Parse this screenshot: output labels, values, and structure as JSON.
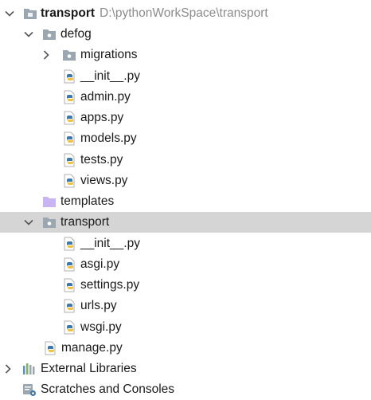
{
  "project_view": {
    "root": {
      "name": "transport",
      "path": "D:\\pythonWorkSpace\\transport"
    },
    "defog": {
      "name": "defog",
      "migrations": "migrations",
      "files": [
        "__init__.py",
        "admin.py",
        "apps.py",
        "models.py",
        "tests.py",
        "views.py"
      ]
    },
    "templates": "templates",
    "transport_pkg": {
      "name": "transport",
      "files": [
        "__init__.py",
        "asgi.py",
        "settings.py",
        "urls.py",
        "wsgi.py"
      ]
    },
    "manage": "manage.py",
    "external_libraries": "External Libraries",
    "scratches": "Scratches and Consoles"
  },
  "colors": {
    "selection": "#d5d5d5",
    "folder": "#9aa7b0",
    "package_folder": "#9aa7b0",
    "templates_folder": "#c9b5f2",
    "python_blue": "#3c78aa",
    "python_yellow": "#f2c23c",
    "path_text": "#8c8c8c"
  }
}
